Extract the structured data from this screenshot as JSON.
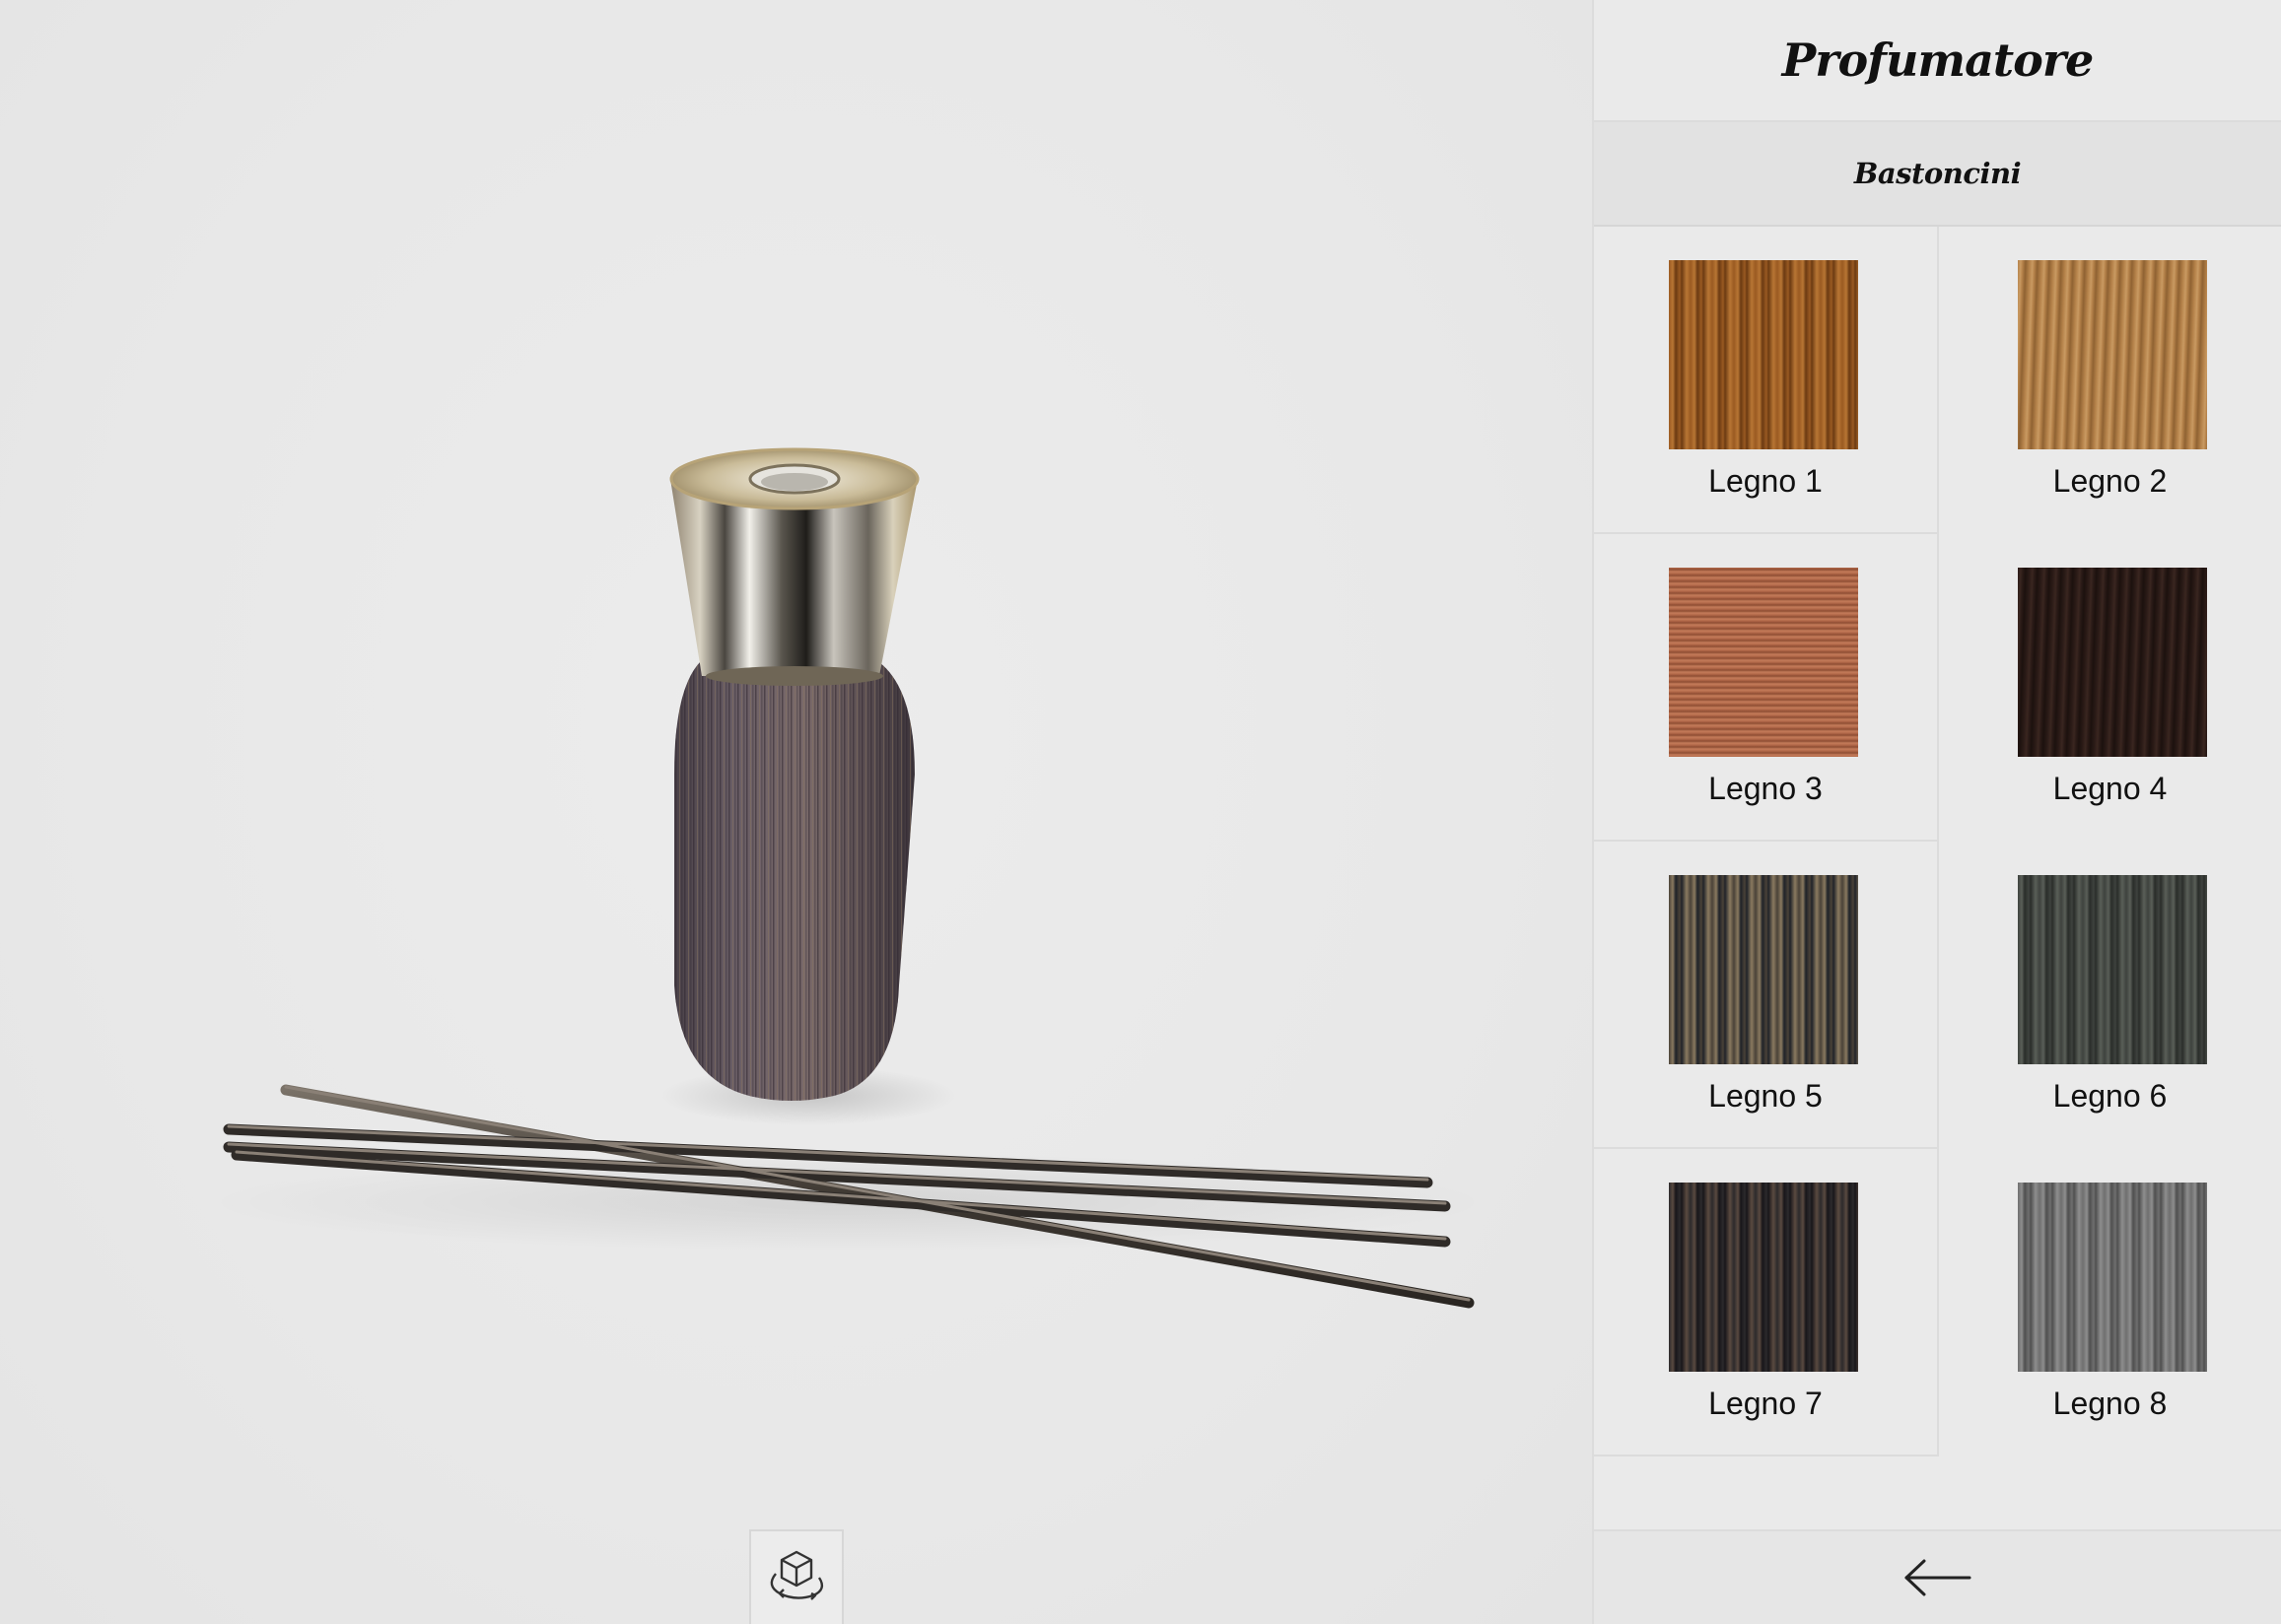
{
  "viewer": {
    "rotate_icon": "rotate-3d-cube-icon"
  },
  "sidebar": {
    "title": "Profumatore",
    "section": "Bastoncini",
    "swatches": [
      {
        "label": "Legno 1",
        "base": "#9a5a22",
        "dark": "#6b3a12",
        "light": "#b87634",
        "style": "stripes-v"
      },
      {
        "label": "Legno 2",
        "base": "#b5824a",
        "dark": "#8f6232",
        "light": "#c99a62",
        "style": "fine"
      },
      {
        "label": "Legno 3",
        "base": "#b3694a",
        "dark": "#8e4e33",
        "light": "#c47c5a",
        "style": "stripes-h"
      },
      {
        "label": "Legno 4",
        "base": "#2b1b17",
        "dark": "#1c110e",
        "light": "#3a2620",
        "style": "fine"
      },
      {
        "label": "Legno 5",
        "base": "#4a4238",
        "dark": "#1f2228",
        "light": "#8a7a60",
        "style": "stripes-v"
      },
      {
        "label": "Legno 6",
        "base": "#3e423e",
        "dark": "#2a2d2a",
        "light": "#5a5f58",
        "style": "stripes-v"
      },
      {
        "label": "Legno 7",
        "base": "#2c2a2c",
        "dark": "#18161a",
        "light": "#5a4a40",
        "style": "stripes-v"
      },
      {
        "label": "Legno 8",
        "base": "#6f6f6f",
        "dark": "#4f4f4f",
        "light": "#8e8e8e",
        "style": "stripes-v"
      }
    ],
    "back_icon": "arrow-left-icon"
  }
}
